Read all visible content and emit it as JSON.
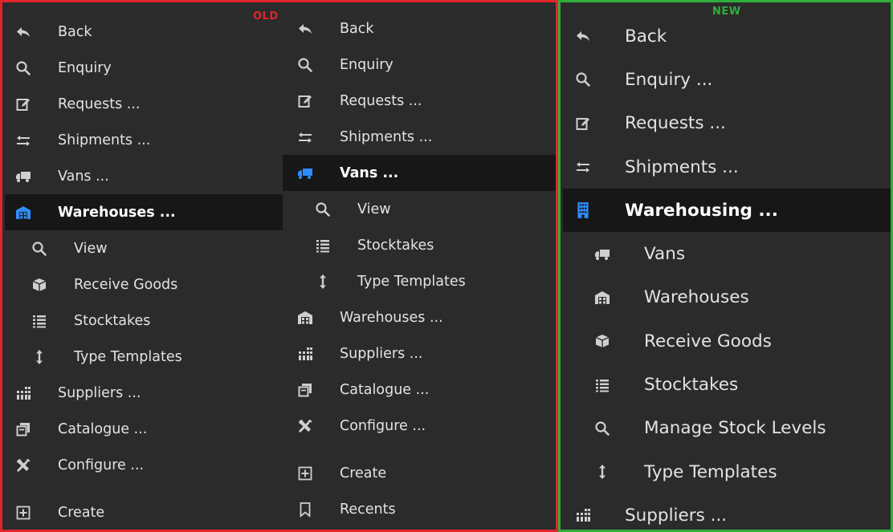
{
  "old": {
    "tag": "OLD",
    "menu_1": [
      {
        "label": "Back",
        "icon": "back-arrow-icon"
      },
      {
        "label": "Enquiry",
        "icon": "search-icon"
      },
      {
        "label": "Requests ...",
        "icon": "edit-icon"
      },
      {
        "label": "Shipments ...",
        "icon": "exchange-icon"
      },
      {
        "label": "Vans ...",
        "icon": "truck-icon"
      },
      {
        "label": "Warehouses ...",
        "icon": "warehouse-icon",
        "active": true
      },
      {
        "label": "View",
        "icon": "search-icon",
        "sub": true
      },
      {
        "label": "Receive Goods",
        "icon": "box-icon",
        "sub": true
      },
      {
        "label": "Stocktakes",
        "icon": "list-icon",
        "sub": true
      },
      {
        "label": "Type Templates",
        "icon": "vertical-arrows-icon",
        "sub": true
      },
      {
        "label": "Suppliers ...",
        "icon": "suppliers-icon"
      },
      {
        "label": "Catalogue ...",
        "icon": "catalogue-icon"
      },
      {
        "label": "Configure ...",
        "icon": "tools-icon"
      },
      {
        "label": "Create",
        "icon": "plus-square-icon"
      }
    ],
    "menu_2": [
      {
        "label": "Back",
        "icon": "back-arrow-icon"
      },
      {
        "label": "Enquiry",
        "icon": "search-icon"
      },
      {
        "label": "Requests ...",
        "icon": "edit-icon"
      },
      {
        "label": "Shipments ...",
        "icon": "exchange-icon"
      },
      {
        "label": "Vans ...",
        "icon": "truck-icon",
        "active": true
      },
      {
        "label": "View",
        "icon": "search-icon",
        "sub": true
      },
      {
        "label": "Stocktakes",
        "icon": "list-icon",
        "sub": true
      },
      {
        "label": "Type Templates",
        "icon": "vertical-arrows-icon",
        "sub": true
      },
      {
        "label": "Warehouses ...",
        "icon": "warehouse-icon"
      },
      {
        "label": "Suppliers ...",
        "icon": "suppliers-icon"
      },
      {
        "label": "Catalogue ...",
        "icon": "catalogue-icon"
      },
      {
        "label": "Configure ...",
        "icon": "tools-icon"
      },
      {
        "label": "Create",
        "icon": "plus-square-icon"
      },
      {
        "label": "Recents",
        "icon": "bookmark-icon"
      }
    ]
  },
  "new": {
    "tag": "NEW",
    "menu": [
      {
        "label": "Back",
        "icon": "back-arrow-icon"
      },
      {
        "label": "Enquiry ...",
        "icon": "search-icon"
      },
      {
        "label": "Requests ...",
        "icon": "edit-icon"
      },
      {
        "label": "Shipments ...",
        "icon": "exchange-icon"
      },
      {
        "label": "Warehousing ...",
        "icon": "building-icon",
        "active": true
      },
      {
        "label": "Vans",
        "icon": "truck-icon",
        "sub": true
      },
      {
        "label": "Warehouses",
        "icon": "warehouse-icon",
        "sub": true
      },
      {
        "label": "Receive Goods",
        "icon": "box-icon",
        "sub": true
      },
      {
        "label": "Stocktakes",
        "icon": "list-icon",
        "sub": true
      },
      {
        "label": "Manage Stock Levels",
        "icon": "search-icon",
        "sub": true
      },
      {
        "label": "Type Templates",
        "icon": "vertical-arrows-icon",
        "sub": true
      },
      {
        "label": "Suppliers ...",
        "icon": "suppliers-icon"
      }
    ]
  }
}
